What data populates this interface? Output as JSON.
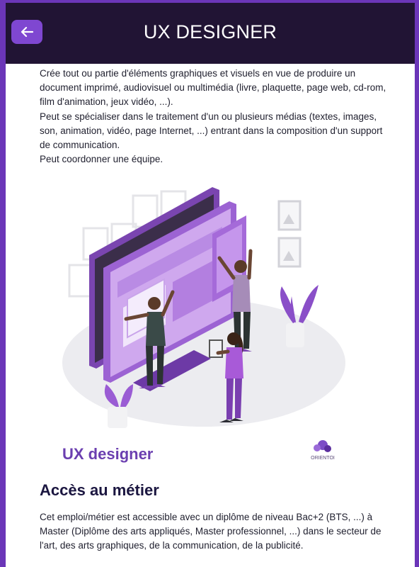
{
  "header": {
    "title": "UX DESIGNER",
    "back_icon": "arrow-left-icon"
  },
  "intro": {
    "p1": "Crée tout ou partie d'éléments graphiques et visuels en vue de produire un document imprimé, audiovisuel ou multimédia (livre, plaquette, page web, cd-rom, film d'animation, jeux vidéo, ...).",
    "p2": "Peut se spécialiser dans le traitement d'un ou plusieurs médias (textes, images, son, animation, vidéo, page Internet, ...) entrant dans la composition d'un support de communication.",
    "p3": "Peut coordonner une équipe."
  },
  "illustration": {
    "caption": "UX designer",
    "logo_text": "ORIENTOI"
  },
  "access": {
    "title": "Accès au métier",
    "body": "Cet emploi/métier est accessible avec un diplôme de niveau Bac+2 (BTS, ...) à Master (Diplôme des arts appliqués, Master professionnel, ...) dans le secteur de l'art, des arts graphiques, de la communication, de la publicité."
  },
  "colors": {
    "header_bg": "#211434",
    "accent": "#7f47d1",
    "frame": "#6b36b8",
    "caption": "#6b3fb0"
  }
}
